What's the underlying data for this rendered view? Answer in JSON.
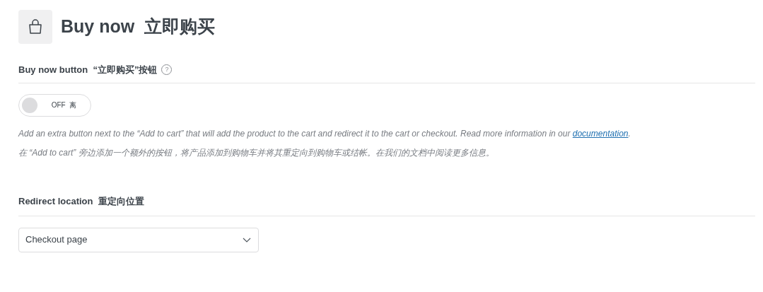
{
  "header": {
    "title": "Buy now  立即购买"
  },
  "buy_now_button": {
    "label": "Buy now button  “立即购买”按钮",
    "help": "?",
    "toggle": {
      "on": false,
      "text": "OFF  离"
    },
    "description": "Add an extra button next to the “Add to cart” that will add the product to the cart and redirect it to the cart or checkout. Read more information in our ",
    "link": "documentation",
    "description_end": ".",
    "description_zh": "在 “Add to cart” 旁边添加一个额外的按钮，将产品添加到购物车并将其重定向到购物车或结帐。在我们的文档中阅读更多信息。"
  },
  "redirect_location": {
    "label": "Redirect location  重定向位置",
    "select": {
      "value": "Checkout page"
    }
  }
}
